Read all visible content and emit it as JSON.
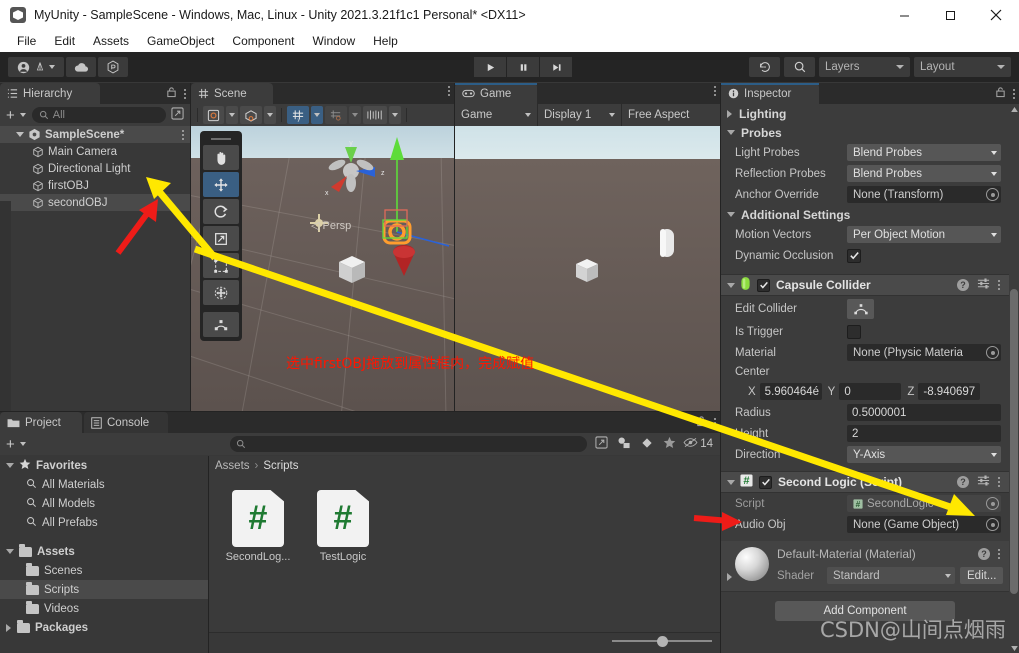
{
  "window": {
    "title": "MyUnity - SampleScene - Windows, Mac, Linux - Unity 2021.3.21f1c1 Personal* <DX11>",
    "minimize": "—",
    "maximize": "□",
    "close": "✕"
  },
  "menu": {
    "items": [
      "File",
      "Edit",
      "Assets",
      "GameObject",
      "Component",
      "Window",
      "Help"
    ]
  },
  "toolbar": {
    "account_icon": "account-icon",
    "cloud_icon": "cloud-icon",
    "services_icon": "services-icon",
    "play": "▶",
    "pause": "❚❚",
    "step": "▶❙",
    "undo_history_icon": "undo-history-icon",
    "search_icon": "search-icon",
    "layers_label": "Layers",
    "layout_label": "Layout"
  },
  "hierarchy": {
    "tab": "Hierarchy",
    "lock_icon": "lock-icon",
    "menu_icon": "kebab-menu-icon",
    "add_label": "+",
    "search_placeholder": "All",
    "scene_root": "SampleScene*",
    "items": [
      {
        "label": "Main Camera"
      },
      {
        "label": "Directional Light"
      },
      {
        "label": "firstOBJ"
      },
      {
        "label": "secondOBJ",
        "selected": true
      }
    ]
  },
  "scene": {
    "tab": "Scene",
    "menu_icon": "kebab-menu-icon",
    "toolbar": {
      "draw_mode": "shaded-mode-icon",
      "2d_icon": "2d-toggle-icon",
      "lighting_icon": "scene-lighting-icon",
      "audio_icon": "scene-audio-icon",
      "fx_icon": "scene-effects-icon",
      "gizmos_icon": "gizmos-icon"
    },
    "tools": [
      {
        "name": "hand-tool",
        "glyph": "hand"
      },
      {
        "name": "move-tool",
        "glyph": "move",
        "active": true
      },
      {
        "name": "rotate-tool",
        "glyph": "rotate"
      },
      {
        "name": "scale-tool",
        "glyph": "scale"
      },
      {
        "name": "rect-tool",
        "glyph": "rect"
      },
      {
        "name": "transform-tool",
        "glyph": "transform"
      },
      {
        "name": "custom-tool",
        "glyph": "custom"
      }
    ],
    "gizmo_axes": {
      "x": "x",
      "y": "y",
      "z": "z"
    },
    "perspective_label": "Persp"
  },
  "game": {
    "tab": "Game",
    "menu_icon": "kebab-menu-icon",
    "display_mode": "Game",
    "display": "Display 1",
    "aspect": "Free Aspect"
  },
  "inspector": {
    "tab": "Inspector",
    "lock_icon": "lock-icon",
    "menu_icon": "kebab-menu-icon",
    "sections": {
      "lighting": "Lighting",
      "probes": "Probes",
      "additional_settings": "Additional Settings"
    },
    "probes": [
      {
        "label": "Light Probes",
        "value": "Blend Probes",
        "type": "dropdown"
      },
      {
        "label": "Reflection Probes",
        "value": "Blend Probes",
        "type": "dropdown"
      },
      {
        "label": "Anchor Override",
        "value": "None (Transform)",
        "type": "object"
      }
    ],
    "additional": [
      {
        "label": "Motion Vectors",
        "value": "Per Object Motion",
        "type": "dropdown"
      },
      {
        "label": "Dynamic Occlusion",
        "value": "checked",
        "type": "checkbox"
      }
    ],
    "capsule_collider": {
      "title": "Capsule Collider",
      "enabled": true,
      "help_icon": "help-icon",
      "preset_icon": "preset-icon",
      "menu_icon": "kebab-menu-icon",
      "edit_collider_label": "Edit Collider",
      "edit_collider_icon": "edit-collider-icon",
      "is_trigger_label": "Is Trigger",
      "is_trigger_value": false,
      "material_label": "Material",
      "material_value": "None (Physic Materia",
      "center_label": "Center",
      "center": {
        "x_label": "X",
        "x": "5.960464é",
        "y_label": "Y",
        "y": "0",
        "z_label": "Z",
        "z": "-8.940697"
      },
      "radius_label": "Radius",
      "radius": "0.5000001",
      "height_label": "Height",
      "height": "2",
      "direction_label": "Direction",
      "direction": "Y-Axis"
    },
    "second_logic": {
      "title": "Second Logic (Script)",
      "enabled": true,
      "script_label": "Script",
      "script_value": "SecondLogic",
      "audio_obj_label": "Audio Obj",
      "audio_obj_value": "None (Game Object)"
    },
    "material": {
      "title": "Default-Material (Material)",
      "shader_label": "Shader",
      "shader_value": "Standard",
      "edit_button": "Edit..."
    },
    "add_component": "Add Component"
  },
  "project": {
    "tab": "Project",
    "console_tab": "Console",
    "lock_icon": "lock-icon",
    "menu_icon": "kebab-menu-icon",
    "add_label": "+",
    "search_placeholder": "",
    "filter_type_icon": "filter-type-icon",
    "filter_label_icon": "filter-label-icon",
    "favorite_icon": "star-icon",
    "hidden_count": "14",
    "hidden_icon": "hidden-eye-icon",
    "tree": [
      {
        "label": "Favorites",
        "type": "group",
        "icon": "star-icon",
        "expanded": true
      },
      {
        "label": "All Materials",
        "type": "search",
        "indent": 1
      },
      {
        "label": "All Models",
        "type": "search",
        "indent": 1
      },
      {
        "label": "All Prefabs",
        "type": "search",
        "indent": 1
      },
      {
        "label": "Assets",
        "type": "group",
        "icon": "folder-icon",
        "expanded": true
      },
      {
        "label": "Scenes",
        "type": "folder",
        "indent": 1
      },
      {
        "label": "Scripts",
        "type": "folder",
        "indent": 1,
        "selected": true
      },
      {
        "label": "Videos",
        "type": "folder",
        "indent": 1
      },
      {
        "label": "Packages",
        "type": "group",
        "icon": "folder-icon",
        "expanded": false
      }
    ],
    "breadcrumb": [
      "Assets",
      "Scripts"
    ],
    "assets": [
      {
        "label": "SecondLog...",
        "icon": "csharp-script-icon",
        "glyph": "#"
      },
      {
        "label": "TestLogic",
        "icon": "csharp-script-icon",
        "glyph": "#"
      }
    ]
  },
  "annotations": {
    "instruction_text": "选中firstOBJ拖放到属性框内，完成赋值",
    "watermark": "CSDN@山间点烟雨",
    "arrow_color_red": "#ee1c18",
    "arrow_color_yellow": "#ffe800"
  }
}
